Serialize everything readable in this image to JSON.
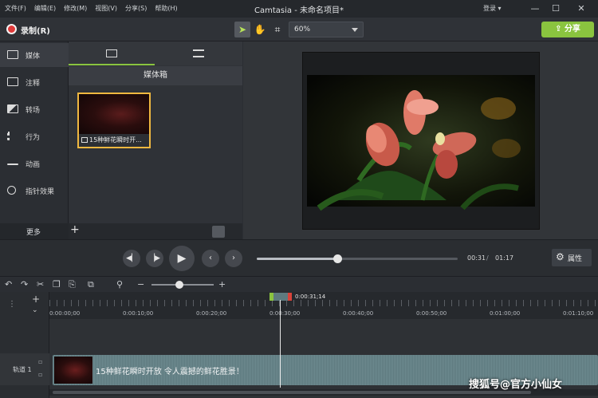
{
  "menu": [
    "文件(F)",
    "编辑(E)",
    "修改(M)",
    "视图(V)",
    "分享(S)",
    "帮助(H)"
  ],
  "window_title": "Camtasia - 未命名项目*",
  "login_label": "登录 ▾",
  "toolbar": {
    "record_label": "录制(R)",
    "zoom_value": "60%",
    "share_label": "分享"
  },
  "sidebar": {
    "items": [
      {
        "label": "媒体",
        "icon": "film-icon"
      },
      {
        "label": "注释",
        "icon": "annotation-icon"
      },
      {
        "label": "转场",
        "icon": "transition-icon"
      },
      {
        "label": "行为",
        "icon": "behavior-icon"
      },
      {
        "label": "动画",
        "icon": "animation-icon"
      },
      {
        "label": "指针效果",
        "icon": "cursor-icon"
      }
    ],
    "more_label": "更多"
  },
  "media": {
    "bin_title": "媒体箱",
    "clip_name": "15种鲜花瞬时开..."
  },
  "player": {
    "current_time": "00:31",
    "separator": "/",
    "total_time": "01:17",
    "progress": 0.4,
    "properties_label": "属性"
  },
  "timeline": {
    "playhead_time": "0:00:31;14",
    "ruler_labels": [
      "0:00:00;00",
      "0:00:10;00",
      "0:00:20;00",
      "0:00:30;00",
      "0:00:40;00",
      "0:00:50;00",
      "0:01:00;00",
      "0:01:10;00"
    ],
    "track_label": "轨道 1",
    "clip_title": "15种鲜花瞬时开放 令人震撼的鲜花胜景！",
    "zoom_level": 0.45
  },
  "watermark": "搜狐号@官方小仙女",
  "colors": {
    "accent": "#8ac43f",
    "record": "#e03a3a",
    "selection": "#f0b840"
  }
}
